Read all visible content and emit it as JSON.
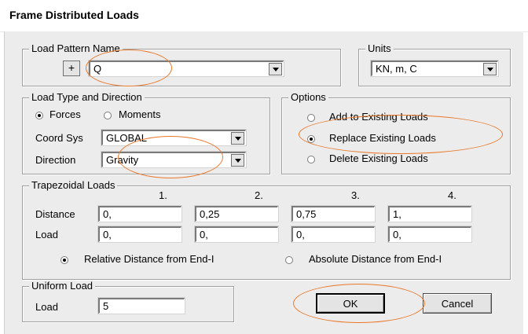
{
  "window": {
    "title": "Frame Distributed Loads"
  },
  "load_pattern": {
    "legend": "Load Pattern Name",
    "add_label": "+",
    "value": "Q"
  },
  "units": {
    "legend": "Units",
    "value": "KN, m, C"
  },
  "load_type": {
    "legend": "Load Type and Direction",
    "forces_label": "Forces",
    "moments_label": "Moments",
    "selected": "Forces",
    "coord_sys_label": "Coord Sys",
    "coord_sys_value": "GLOBAL",
    "direction_label": "Direction",
    "direction_value": "Gravity"
  },
  "options": {
    "legend": "Options",
    "add_label": "Add to Existing Loads",
    "replace_label": "Replace Existing Loads",
    "delete_label": "Delete Existing Loads",
    "selected": "Replace Existing Loads"
  },
  "trapezoidal": {
    "legend": "Trapezoidal Loads",
    "columns": [
      "1.",
      "2.",
      "3.",
      "4."
    ],
    "distance_label": "Distance",
    "distances": [
      "0,",
      "0,25",
      "0,75",
      "1,"
    ],
    "load_label": "Load",
    "loads": [
      "0,",
      "0,",
      "0,",
      "0,"
    ],
    "relative_label": "Relative Distance from End-I",
    "absolute_label": "Absolute Distance from End-I",
    "selected": "Relative Distance from End-I"
  },
  "uniform": {
    "legend": "Uniform Load",
    "load_label": "Load",
    "load_value": "5"
  },
  "buttons": {
    "ok": "OK",
    "cancel": "Cancel"
  },
  "colors": {
    "highlight_ring": "#e9782a",
    "dialog_bg": "#ececec"
  }
}
